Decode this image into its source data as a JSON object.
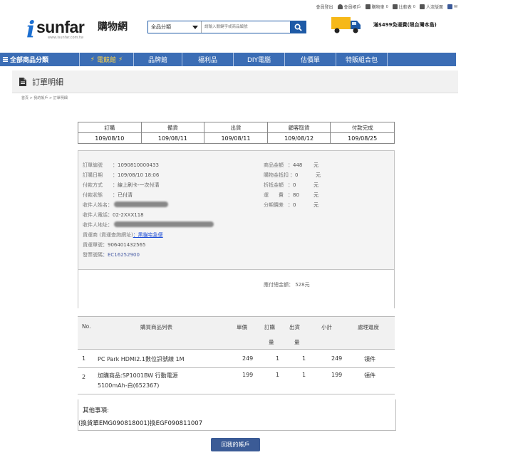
{
  "util_bar": {
    "items": [
      "會員登出",
      "會員帳戶",
      "購物車",
      "比較表",
      "人流版面"
    ],
    "cart_count": "0",
    "compare_count": "0"
  },
  "brand": {
    "logo_i": "i",
    "logo_text": "sunfar",
    "logo_cn": "購物網",
    "logo_url": "www.isunfar.com.tw"
  },
  "search": {
    "category": "全品分類",
    "placeholder": "請輸入關鍵字或商品編號"
  },
  "shipping": {
    "text": "滿$499免運費(限台灣本島)"
  },
  "nav": {
    "items": [
      "全部商品分類",
      "電競館",
      "品牌館",
      "福利品",
      "DIY電腦",
      "估價單",
      "特販組合包"
    ]
  },
  "page": {
    "title": "訂單明細",
    "breadcrumb": "首頁 > 我的帳戶 > 訂單明細"
  },
  "status": {
    "columns": [
      {
        "label": "訂購",
        "date": "109/08/10"
      },
      {
        "label": "備貨",
        "date": "109/08/11"
      },
      {
        "label": "出貨",
        "date": "109/08/11"
      },
      {
        "label": "顧客取貨",
        "date": "109/08/12"
      },
      {
        "label": "付款完成",
        "date": "109/08/25"
      }
    ]
  },
  "order_info": {
    "order_no_label": "訂單編號",
    "order_no": "：1090810000433",
    "order_date_label": "訂購日期",
    "order_date": "：109/08/10 18:06",
    "pay_method_label": "付款方式",
    "pay_method": "：線上刷卡-一次付清",
    "pay_status_label": "付款狀態",
    "pay_status": "：已付清",
    "recipient_label": "收件人姓名",
    "recipient": "：",
    "phone_label": "收件人電話",
    "phone": "：02-2XXX118",
    "address_label": "收件人地址",
    "address": "：",
    "carrier_label": "貨運商 (貨運查詢網址)",
    "carrier": "：黑貓宅急便",
    "tracking_label": "貨運單號",
    "tracking": "：906401432565",
    "invoice_label": "發票號碼",
    "invoice": "：EC16252900"
  },
  "amounts": {
    "goods_label": "商品金額",
    "goods": "：448",
    "unit1": "元",
    "points_label": "購物金抵扣",
    "points": "：0",
    "unit2": "元",
    "discount_label": "折抵金額",
    "discount": "：0",
    "unit3": "元",
    "shipping_label": "運　　費",
    "shipping": "：80",
    "unit4": "元",
    "installment_label": "分期價差",
    "installment": "：0",
    "unit5": "元",
    "total": "應付總金額： 528元"
  },
  "products": {
    "headers": {
      "no": "No.",
      "name": "購買商品列表",
      "price": "單價",
      "qty1": "訂購",
      "qty2": "量",
      "ship1": "出貨",
      "ship2": "量",
      "subtotal": "小計",
      "progress": "處理進度"
    },
    "rows": [
      {
        "no": "1",
        "name": "PC Park HDMI2.1數位訊號線 1M",
        "price": "249",
        "qty": "1",
        "ship": "1",
        "subtotal": "249",
        "progress": "領件"
      },
      {
        "no": "2",
        "name_1": "加購商品:SP1001BW 行動電源",
        "name_2": "5100mAh-白(652367)",
        "price": "199",
        "qty": "1",
        "ship": "1",
        "subtotal": "199",
        "progress": "領件"
      }
    ]
  },
  "remark": {
    "label": "其他事項:",
    "value": "(換貨單EMG090818001)換EGF090811007"
  },
  "back_button": "回我的帳戶"
}
